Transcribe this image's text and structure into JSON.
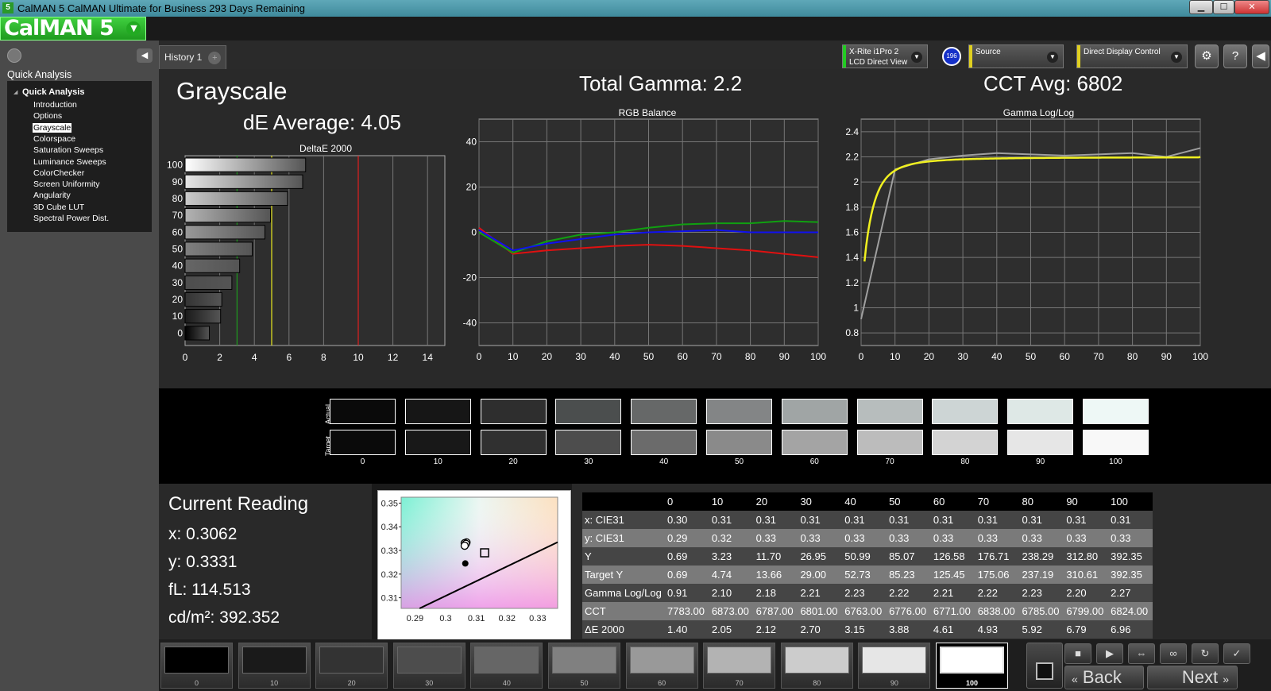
{
  "window": {
    "title": "CalMAN 5 CalMAN Ultimate for Business 293 Days Remaining",
    "app_icon": "5",
    "minimize": "▁",
    "maximize": "☐",
    "close": "✕"
  },
  "logo": {
    "text": "CalMAN 5"
  },
  "sidebar": {
    "heading": "Quick Analysis",
    "root": "Quick Analysis",
    "items": [
      {
        "label": "Introduction"
      },
      {
        "label": "Options"
      },
      {
        "label": "Grayscale",
        "selected": true
      },
      {
        "label": "Colorspace"
      },
      {
        "label": "Saturation Sweeps"
      },
      {
        "label": "Luminance Sweeps"
      },
      {
        "label": "ColorChecker"
      },
      {
        "label": "Screen Uniformity"
      },
      {
        "label": "Angularity"
      },
      {
        "label": "3D Cube LUT"
      },
      {
        "label": "Spectral Power Dist."
      }
    ]
  },
  "tabs": {
    "history": "History 1",
    "add": "+"
  },
  "devices": {
    "meter_line1": "X-Rite i1Pro 2",
    "meter_line2": "LCD Direct View",
    "meter_badge": "196",
    "source": "Source",
    "display": "Direct Display Control"
  },
  "header": {
    "title": "Grayscale",
    "de_average": "dE Average: 4.05",
    "total_gamma": "Total Gamma: 2.2",
    "cct_avg": "CCT Avg: 6802"
  },
  "chart_data": [
    {
      "type": "bar",
      "title": "DeltaE 2000",
      "categories": [
        "0",
        "10",
        "20",
        "30",
        "40",
        "50",
        "60",
        "70",
        "80",
        "90",
        "100"
      ],
      "values": [
        1.4,
        2.05,
        2.12,
        2.7,
        3.15,
        3.88,
        4.61,
        4.93,
        5.92,
        6.79,
        6.96
      ],
      "xlim": [
        0,
        15
      ],
      "xticks": [
        "0",
        "2",
        "4",
        "6",
        "8",
        "10",
        "12",
        "14"
      ],
      "reference_lines": [
        {
          "x": 3,
          "color": "#1f9a1f"
        },
        {
          "x": 5,
          "color": "#e8e820"
        },
        {
          "x": 10,
          "color": "#e02020"
        }
      ]
    },
    {
      "type": "line",
      "title": "RGB Balance",
      "x": [
        0,
        10,
        20,
        30,
        40,
        50,
        60,
        70,
        80,
        90,
        100
      ],
      "ylim": [
        -50,
        50
      ],
      "yticks": [
        "40",
        "20",
        "0",
        "-20",
        "-40"
      ],
      "xticks": [
        "0",
        "10",
        "20",
        "30",
        "40",
        "50",
        "60",
        "70",
        "80",
        "90",
        "100"
      ],
      "series": [
        {
          "color": "#e01010",
          "values": [
            2,
            -9.5,
            -8,
            -7,
            -6,
            -5.5,
            -6,
            -7,
            -8,
            -9.5,
            -11
          ]
        },
        {
          "color": "#10a010",
          "values": [
            0,
            -9,
            -4,
            -1,
            0,
            2,
            3.5,
            4,
            4,
            5,
            4.5
          ]
        },
        {
          "color": "#1010f0",
          "values": [
            1,
            -8,
            -5,
            -3,
            -1,
            0,
            0.5,
            1,
            0,
            0,
            0
          ]
        }
      ]
    },
    {
      "type": "line",
      "title": "Gamma Log/Log",
      "x": [
        0,
        10,
        20,
        30,
        40,
        50,
        60,
        70,
        80,
        90,
        100
      ],
      "ylim": [
        0.7,
        2.5
      ],
      "yticks": [
        "2.4",
        "2.2",
        "2",
        "1.8",
        "1.6",
        "1.4",
        "1.2",
        "1",
        "0.8"
      ],
      "xticks": [
        "0",
        "10",
        "20",
        "30",
        "40",
        "50",
        "60",
        "70",
        "80",
        "90",
        "100"
      ],
      "series": [
        {
          "color": "#a0a0a0",
          "values": [
            0.91,
            2.1,
            2.18,
            2.21,
            2.23,
            2.22,
            2.21,
            2.22,
            2.23,
            2.2,
            2.27
          ]
        },
        {
          "color": "#f0f020",
          "target_gamma": 2.2
        }
      ]
    }
  ],
  "swatch_panel": {
    "actual_label": "Actual",
    "target_label": "Target",
    "labels": [
      "0",
      "10",
      "20",
      "30",
      "40",
      "50",
      "60",
      "70",
      "80",
      "90",
      "100"
    ],
    "actual": [
      "#0a0a0a",
      "#161616",
      "#2e2e2e",
      "#4b4e4e",
      "#666868",
      "#838586",
      "#a0a5a5",
      "#b7bdbd",
      "#cdd5d5",
      "#dee8e6",
      "#eef8f6"
    ],
    "target": [
      "#0a0a0a",
      "#181818",
      "#303030",
      "#4d4d4d",
      "#6b6b6b",
      "#8a8a8a",
      "#a4a4a4",
      "#bcbcbc",
      "#d3d3d3",
      "#e6e6e6",
      "#f8f8f8"
    ]
  },
  "current_reading": {
    "title": "Current Reading",
    "x": "x: 0.3062",
    "y": "y: 0.3331",
    "fl": "fL: 114.513",
    "cd": "cd/m²: 392.352"
  },
  "cie_plot": {
    "yticks": [
      "0.35",
      "0.34",
      "0.33",
      "0.32",
      "0.31"
    ],
    "xticks": [
      "0.29",
      "0.3",
      "0.31",
      "0.32",
      "0.33"
    ],
    "target_x": 0.3127,
    "target_y": 0.329,
    "measured": [
      [
        0.3068,
        0.3334
      ],
      [
        0.3062,
        0.3331
      ],
      [
        0.3066,
        0.3328
      ],
      [
        0.3062,
        0.332
      ]
    ],
    "dark_point": [
      0.3064,
      0.3245
    ]
  },
  "table": {
    "headers": [
      "",
      "0",
      "10",
      "20",
      "30",
      "40",
      "50",
      "60",
      "70",
      "80",
      "90",
      "100"
    ],
    "rows": [
      [
        "x: CIE31",
        "0.30",
        "0.31",
        "0.31",
        "0.31",
        "0.31",
        "0.31",
        "0.31",
        "0.31",
        "0.31",
        "0.31",
        "0.31"
      ],
      [
        "y: CIE31",
        "0.29",
        "0.32",
        "0.33",
        "0.33",
        "0.33",
        "0.33",
        "0.33",
        "0.33",
        "0.33",
        "0.33",
        "0.33"
      ],
      [
        "Y",
        "0.69",
        "3.23",
        "11.70",
        "26.95",
        "50.99",
        "85.07",
        "126.58",
        "176.71",
        "238.29",
        "312.80",
        "392.35"
      ],
      [
        "Target Y",
        "0.69",
        "4.74",
        "13.66",
        "29.00",
        "52.73",
        "85.23",
        "125.45",
        "175.06",
        "237.19",
        "310.61",
        "392.35"
      ],
      [
        "Gamma Log/Log",
        "0.91",
        "2.10",
        "2.18",
        "2.21",
        "2.23",
        "2.22",
        "2.21",
        "2.22",
        "2.23",
        "2.20",
        "2.27"
      ],
      [
        "CCT",
        "7783.00",
        "6873.00",
        "6787.00",
        "6801.00",
        "6763.00",
        "6776.00",
        "6771.00",
        "6838.00",
        "6785.00",
        "6799.00",
        "6824.00"
      ],
      [
        "ΔE 2000",
        "1.40",
        "2.05",
        "2.12",
        "2.70",
        "3.15",
        "3.88",
        "4.61",
        "4.93",
        "5.92",
        "6.79",
        "6.96"
      ]
    ]
  },
  "bottom": {
    "patches": [
      {
        "label": "0",
        "color": "#000000"
      },
      {
        "label": "10",
        "color": "#1a1a1a"
      },
      {
        "label": "20",
        "color": "#333333"
      },
      {
        "label": "30",
        "color": "#4d4d4d"
      },
      {
        "label": "40",
        "color": "#666666"
      },
      {
        "label": "50",
        "color": "#808080"
      },
      {
        "label": "60",
        "color": "#999999"
      },
      {
        "label": "70",
        "color": "#b3b3b3"
      },
      {
        "label": "80",
        "color": "#cccccc"
      },
      {
        "label": "90",
        "color": "#e6e6e6"
      },
      {
        "label": "100",
        "color": "#ffffff",
        "selected": true
      }
    ],
    "back": "Back",
    "next": "Next"
  }
}
